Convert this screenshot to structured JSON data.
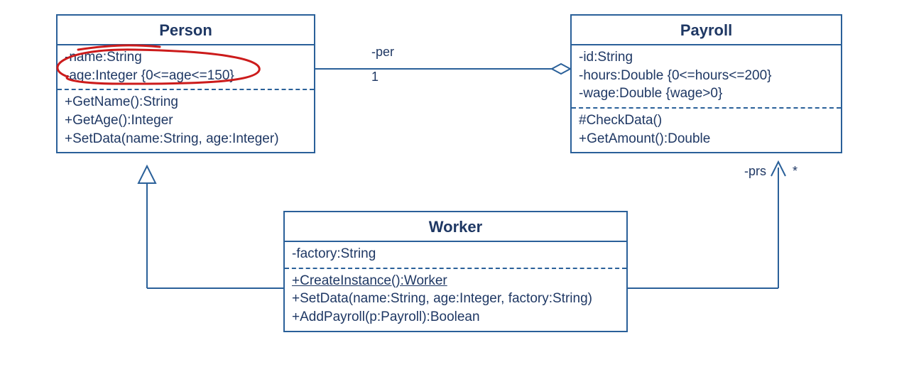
{
  "classes": {
    "person": {
      "name": "Person",
      "attributes": [
        "-name:String",
        "-age:Integer {0<=age<=150}"
      ],
      "operations": [
        "+GetName():String",
        "+GetAge():Integer",
        "+SetData(name:String, age:Integer)"
      ]
    },
    "payroll": {
      "name": "Payroll",
      "attributes": [
        "-id:String",
        "-hours:Double {0<=hours<=200}",
        "-wage:Double {wage>0}"
      ],
      "operations": [
        "#CheckData()",
        "+GetAmount():Double"
      ]
    },
    "worker": {
      "name": "Worker",
      "attributes": [
        "-factory:String"
      ],
      "operations_underlined": [
        "+CreateInstance():Worker"
      ],
      "operations": [
        "+SetData(name:String, age:Integer, factory:String)",
        "+AddPayroll(p:Payroll):Boolean"
      ]
    }
  },
  "associations": {
    "person_payroll": {
      "role_label": "-per",
      "multiplicity": "1"
    },
    "worker_payroll": {
      "role_label": "-prs",
      "multiplicity": "*"
    }
  },
  "annotation": {
    "highlight_attribute": "age constraint circled in red"
  }
}
